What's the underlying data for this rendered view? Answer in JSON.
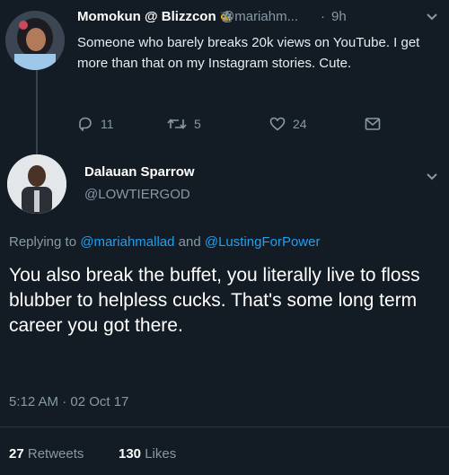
{
  "tweet1": {
    "display_name": "Momokun @ Blizzcon",
    "emoji": "🐝",
    "handle": "@mariahm...",
    "separator": "·",
    "time": "9h",
    "text": "Someone who barely breaks 20k views on YouTube. I get more than that on my Instagram stories. Cute.",
    "actions": {
      "replies": "11",
      "retweets": "5",
      "likes": "24"
    }
  },
  "tweet2": {
    "display_name": "Dalauan Sparrow",
    "handle": "@LOWTIERGOD",
    "replying_prefix": "Replying to",
    "replying_user1": "@mariahmallad",
    "replying_and": "and",
    "replying_user2": "@LustingForPower",
    "text": "You also break the buffet, you literally live to floss blubber to helpless cucks. That's some long term career you got there.",
    "timestamp": "5:12 AM · 02 Oct 17",
    "retweets_count": "27",
    "retweets_label": "Retweets",
    "likes_count": "130",
    "likes_label": "Likes"
  },
  "colors": {
    "background": "#131b24",
    "muted": "#8899a6",
    "link": "#1da1f2",
    "text": "#ffffff"
  },
  "icons": [
    "reply-icon",
    "retweet-icon",
    "like-icon",
    "dm-icon",
    "chevron-down-icon"
  ]
}
